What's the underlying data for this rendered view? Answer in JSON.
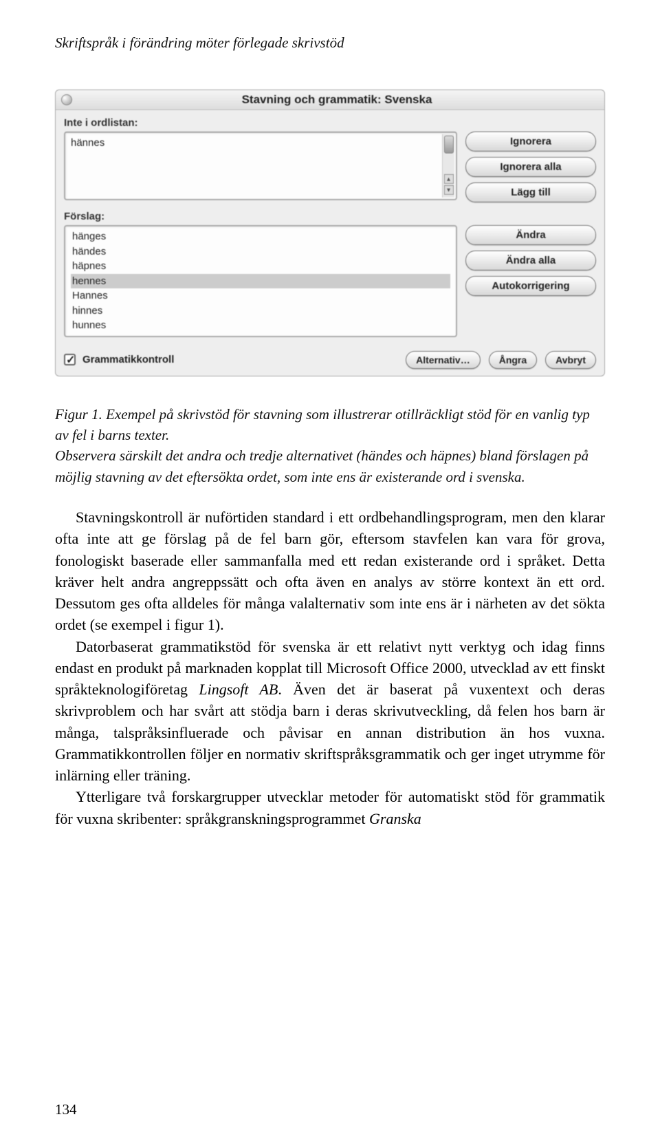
{
  "page": {
    "running_header": "Skriftspråk i förändring möter förlegade skrivstöd",
    "number": "134"
  },
  "dialog": {
    "title": "Stavning och grammatik: Svenska",
    "not_in_dict_label": "Inte i ordlistan:",
    "not_in_dict_value": "hännes",
    "suggestions_label": "Förslag:",
    "suggestions": [
      "hänges",
      "händes",
      "häpnes",
      "hennes",
      "Hannes",
      "hinnes",
      "hunnes"
    ],
    "selected_index": 3,
    "buttons_top": {
      "ignore": "Ignorera",
      "ignore_all": "Ignorera alla",
      "add": "Lägg till"
    },
    "buttons_mid": {
      "change": "Ändra",
      "change_all": "Ändra alla",
      "autocorrect": "Autokorrigering"
    },
    "bottom": {
      "checkbox_label": "Grammatikkontroll",
      "options": "Alternativ…",
      "undo": "Ångra",
      "cancel": "Avbryt"
    }
  },
  "caption": {
    "lead": "Figur 1.",
    "text": " Exempel på skrivstöd för stavning som illustrerar otillräckligt stöd för en vanlig typ av fel i barns texter.",
    "note": "Observera särskilt det andra och tredje alternativet (händes och häpnes) bland förslagen på möjlig stavning av det eftersökta ordet, som inte ens är existerande ord i svenska."
  },
  "body": {
    "p1": "Stavningskontroll är nuförtiden standard i ett ordbehandlingsprogram, men den klarar ofta inte att ge förslag på de fel barn gör, eftersom stavfelen kan vara för grova, fonologiskt baserade eller sammanfalla med ett redan existerande ord i språket. Detta kräver helt andra angreppssätt och ofta även en analys av större kontext än ett ord. Dessutom ges ofta alldeles för många valalternativ som inte ens är i närheten av det sökta ordet (se exempel i figur 1).",
    "p2a": "Datorbaserat grammatikstöd för svenska är ett relativt nytt verktyg och idag finns endast en produkt på marknaden kopplat till Microsoft Office 2000, utvecklad av ett finskt språkteknologiföretag ",
    "p2_em": "Lingsoft AB",
    "p2b": ". Även det är baserat på vuxentext och deras skrivproblem och har svårt att stödja barn i deras skrivutveckling, då felen hos barn är många, talspråksinfluerade och påvisar en annan distribution än hos vuxna. Grammatikkontrollen följer en normativ skriftspråksgrammatik och ger inget utrymme för inlärning eller träning.",
    "p3a": "Ytterligare två forskargrupper utvecklar metoder för automatiskt stöd för grammatik för vuxna skribenter: språkgranskningsprogrammet ",
    "p3_em": "Granska"
  }
}
